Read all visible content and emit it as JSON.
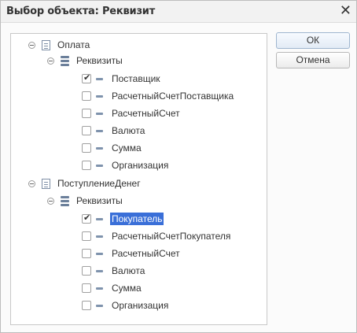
{
  "window": {
    "title": "Выбор объекта: Реквизит",
    "close_glyph": "✕"
  },
  "buttons": {
    "ok": "ОК",
    "cancel": "Отмена"
  },
  "tree": {
    "groups": [
      {
        "name": "Оплата",
        "subgroup": "Реквизиты",
        "items": [
          {
            "label": "Поставщик",
            "checked": true,
            "selected": false
          },
          {
            "label": "РасчетныйСчетПоставщика",
            "checked": false,
            "selected": false
          },
          {
            "label": "РасчетныйСчет",
            "checked": false,
            "selected": false
          },
          {
            "label": "Валюта",
            "checked": false,
            "selected": false
          },
          {
            "label": "Сумма",
            "checked": false,
            "selected": false
          },
          {
            "label": "Организация",
            "checked": false,
            "selected": false
          }
        ]
      },
      {
        "name": "ПоступлениеДенег",
        "subgroup": "Реквизиты",
        "items": [
          {
            "label": "Покупатель",
            "checked": true,
            "selected": true
          },
          {
            "label": "РасчетныйСчетПокупателя",
            "checked": false,
            "selected": false
          },
          {
            "label": "РасчетныйСчет",
            "checked": false,
            "selected": false
          },
          {
            "label": "Валюта",
            "checked": false,
            "selected": false
          },
          {
            "label": "Сумма",
            "checked": false,
            "selected": false
          },
          {
            "label": "Организация",
            "checked": false,
            "selected": false
          }
        ]
      }
    ]
  },
  "colors": {
    "selection": "#3a6fd8"
  }
}
